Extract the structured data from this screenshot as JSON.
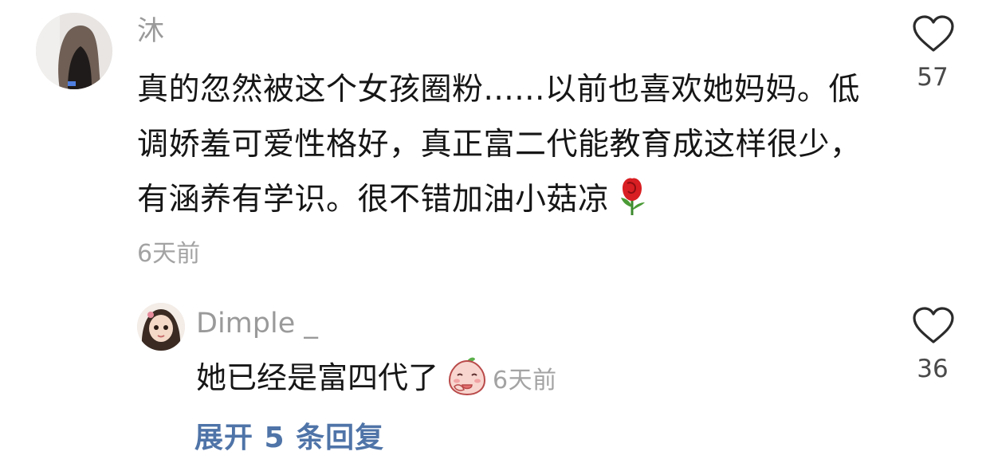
{
  "comment": {
    "username": "沐",
    "avatar_icon": "avatar-photo",
    "text": "真的忽然被这个女孩圈粉......以前也喜欢她妈妈。低调娇羞可爱性格好，真正富二代能教育成这样很少，有涵养有学识。很不错加油小菇凉",
    "emoji": "rose-emoji",
    "time": "6天前",
    "like_count": "57",
    "like_icon": "heart-outline-icon"
  },
  "reply": {
    "username": "Dimple _",
    "avatar_icon": "avatar-photo",
    "text": "她已经是富四代了",
    "emoji": "peach-face-emoji",
    "time": "6天前",
    "like_count": "36",
    "like_icon": "heart-outline-icon"
  },
  "expand": {
    "label": "展开 5 条回复"
  },
  "colors": {
    "text_primary": "#161616",
    "text_secondary": "#9a9a9a",
    "link": "#4f74a8"
  }
}
